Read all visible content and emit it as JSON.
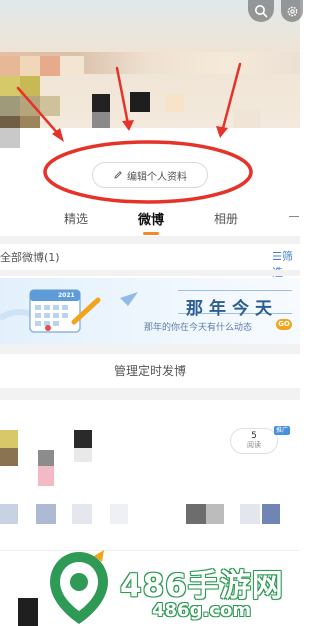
{
  "header": {
    "search_icon": "search-icon",
    "settings_icon": "gear-icon"
  },
  "profile": {
    "edit_label": "编辑个人资料",
    "edit_icon": "pencil-icon"
  },
  "tabs": [
    {
      "label": "精选",
      "active": false
    },
    {
      "label": "微博",
      "active": true
    },
    {
      "label": "相册",
      "active": false
    }
  ],
  "feed": {
    "all_label": "全部微博(1)",
    "filter_label": "筛选",
    "filter_icon": "filter-icon"
  },
  "banner": {
    "title": "那年今天",
    "subtitle": "那年的你在今天有什么动态",
    "go_label": "GO",
    "calendar_year": "2021"
  },
  "schedule": {
    "label": "管理定时发博"
  },
  "post": {
    "promo_tag": "推广",
    "read_count": "5",
    "read_label": "阅读"
  },
  "watermark": {
    "brand": "486手游网",
    "url": "486g.com"
  },
  "colors": {
    "accent_orange": "#f08a2a",
    "annotation_red": "#e6332a",
    "link_blue": "#4a7fd0",
    "watermark_green": "#2e9a55"
  }
}
